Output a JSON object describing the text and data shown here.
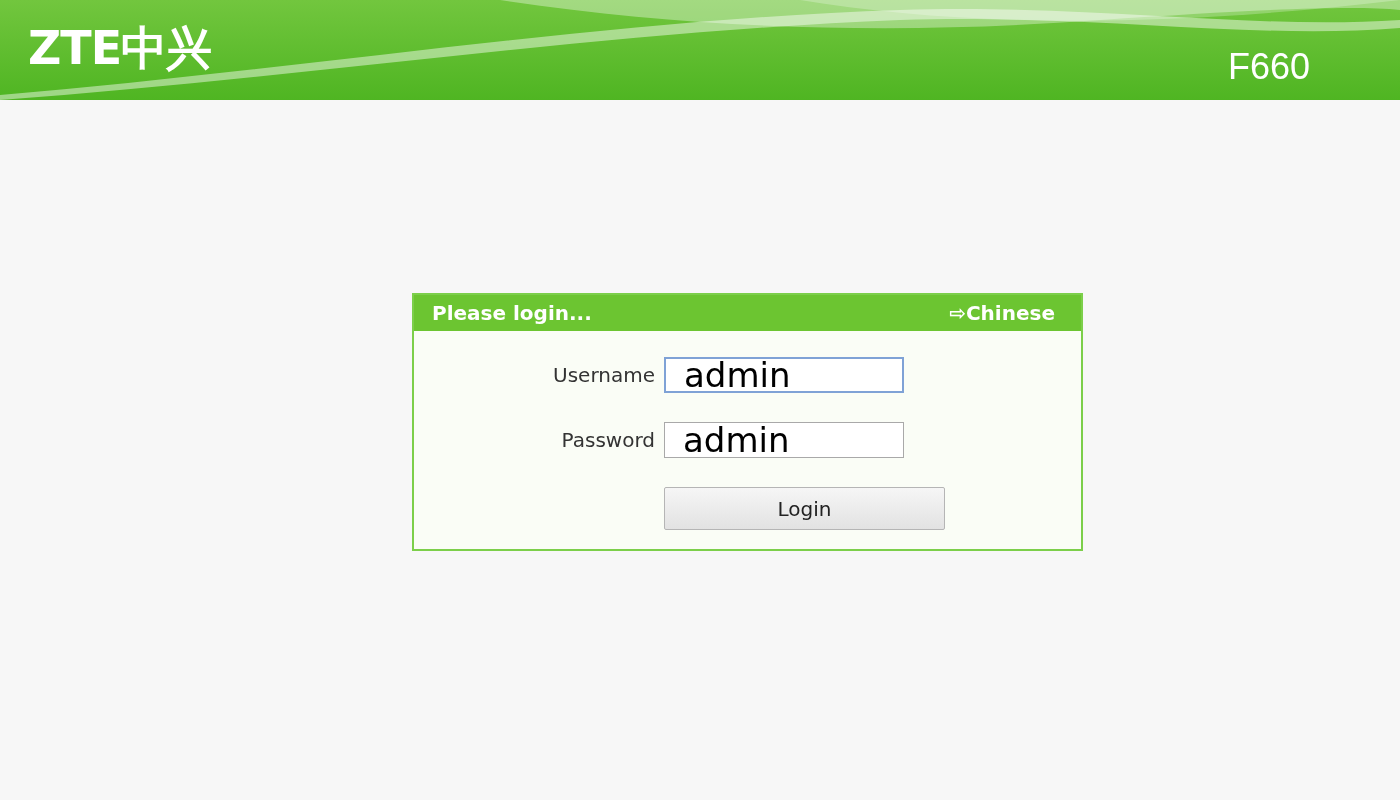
{
  "header": {
    "logo": "ZTE中兴",
    "model": "F660"
  },
  "login": {
    "title": "Please login...",
    "language_link": "⇨Chinese",
    "fields": [
      {
        "label": "Username",
        "value": "admin"
      },
      {
        "label": "Password",
        "value": "admin"
      }
    ],
    "button": "Login"
  }
}
